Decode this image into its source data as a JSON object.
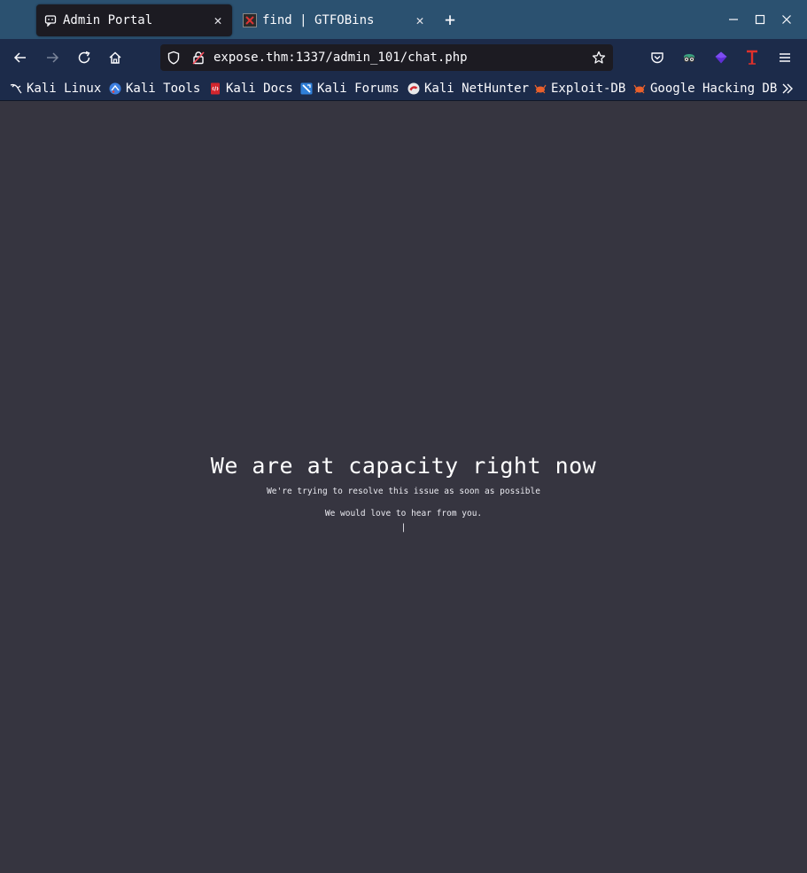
{
  "browser": {
    "tabs": [
      {
        "label": "Admin Portal",
        "active": true,
        "icon": "chat-bubble-icon"
      },
      {
        "label": "find | GTFOBins",
        "active": false,
        "icon": "gtfobins-icon"
      }
    ],
    "new_tab_label": "+",
    "url": "expose.thm:1337/admin_101/chat.php",
    "bookmarks": [
      {
        "label": "Kali Linux",
        "icon": "kali-dragon-icon"
      },
      {
        "label": "Kali Tools",
        "icon": "kali-tools-icon"
      },
      {
        "label": "Kali Docs",
        "icon": "kali-docs-icon"
      },
      {
        "label": "Kali Forums",
        "icon": "kali-forums-icon"
      },
      {
        "label": "Kali NetHunter",
        "icon": "nethunter-icon"
      },
      {
        "label": "Exploit-DB",
        "icon": "exploit-db-icon"
      },
      {
        "label": "Google Hacking DB",
        "icon": "ghdb-icon"
      }
    ],
    "colors": {
      "tabstrip": "#2b5170",
      "toolbar": "#1c2b4a",
      "page_bg": "#363540"
    }
  },
  "page": {
    "headline": "We are at capacity right now",
    "line1": "We're trying to resolve this issue as soon as possible",
    "line2": "We would love to hear from you.",
    "caret": "|"
  }
}
